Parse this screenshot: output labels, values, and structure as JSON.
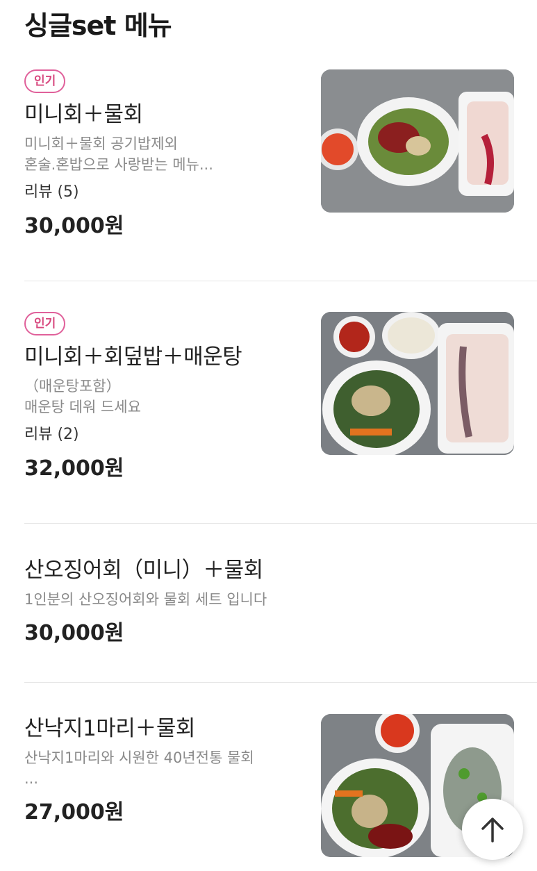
{
  "section": {
    "title": "싱글set 메뉴"
  },
  "items": [
    {
      "badge": "인기",
      "name": "미니회＋물회",
      "desc": "미니회＋물회 공기밥제외\n혼술.혼밥으로 사랑받는 메뉴...",
      "review": "리뷰 (5)",
      "price": "30,000원"
    },
    {
      "badge": "인기",
      "name": "미니회＋회덮밥＋매운탕",
      "desc": "（매운탕포함）\n매운탕 데워 드세요",
      "review": "리뷰 (2)",
      "price": "32,000원"
    },
    {
      "name": "산오징어회（미니）＋물회",
      "desc": "1인분의 산오징어회와 물회 세트 입니다",
      "price": "30,000원"
    },
    {
      "name": "산낙지1마리＋물회",
      "desc": "산낙지1마리와 시원한 40년전통 물회\n...",
      "price": "27,000원"
    }
  ],
  "icons": {
    "scroll_top": "arrow-up-icon"
  },
  "colors": {
    "badge": "#d8497f",
    "price": "#222222",
    "desc": "#8a8a8a"
  }
}
